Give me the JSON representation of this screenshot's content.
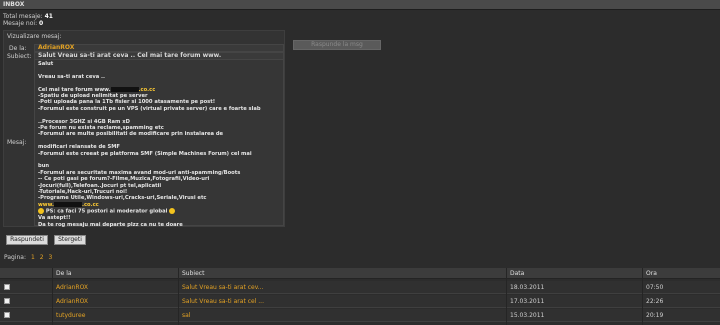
{
  "header": {
    "title": "INBOX"
  },
  "stats": {
    "total_label": "Total mesaje:",
    "total_value": "41",
    "new_label": "Mesaje noi:",
    "new_value": "0"
  },
  "viewer": {
    "title": "Vizualizare mesaj:",
    "from_label": "De la:",
    "from_value": "AdrianROX",
    "subject_label": "Subiect:",
    "subject_value": "Salut Vreau sa-ti arat ceva .. Cel mai tare forum www.",
    "message_label": "Mesaj:",
    "lines": [
      "Salut",
      "",
      "Vreau sa-ti arat ceva ..",
      "",
      "Cel mai tare forum www.",
      "-Spatiu de upload nelimitat pe server",
      "-Poti uploada pana la 1Tb fisier si 1000 atasamente pe post!",
      "-Forumul este construit pe un VPS (virtual private server) care e foarte slab",
      "",
      "..Procesor 3GHZ si 4GB Ram xD",
      "-Pe forum nu exista reclame,spamming etc",
      "-Forumul are multe posibilitati de modificare prin instalarea de",
      "",
      "modificari relansate de SMF",
      "-Forumul este creeat pe platforma SMF (Simple Machines Forum) cel mai",
      "",
      "bun",
      "-Forumul are securitate maxima avand mod-uri anti-spamming/Boots",
      "-- Ce poti gasi pe forum?-Filme,Muzica,Fotografii,Video-uri",
      "-Jocuri(full),Telefoan..Jocuri pt tel,aplicatii",
      "-Tutoriale,Hack-uri,Trucuri noi!",
      "-Programe Utile,Windows-uri,Cracks-uri,Seriale,Virusi etc",
      "www.",
      "PS:  ca faci 75 postori ai moderator global",
      "Va astept!!",
      "Da te rog mesaju mai departe plzz ca nu te doare"
    ],
    "domain_suffix": ".co.cc"
  },
  "buttons": {
    "ghost": "Raspunde la msg",
    "reply": "Raspundeti",
    "delete": "Stergeti"
  },
  "pager": {
    "label": "Pagina:",
    "pages": [
      "1",
      "2",
      "3"
    ]
  },
  "table": {
    "columns": [
      "De la",
      "Subiect",
      "Data",
      "Ora"
    ],
    "rows": [
      {
        "from": "AdrianROX",
        "subject": "Salut Vreau sa-ti arat cev...",
        "date": "18.03.2011",
        "time": "07:50"
      },
      {
        "from": "AdrianROX",
        "subject": "Salut Vreau sa-ti arat cel ...",
        "date": "17.03.2011",
        "time": "22:26"
      },
      {
        "from": "tutyduree",
        "subject": "sal",
        "date": "15.03.2011",
        "time": "20:19"
      }
    ]
  },
  "colors": {
    "accent": "#e3a224",
    "background": "#2c2c2c"
  }
}
